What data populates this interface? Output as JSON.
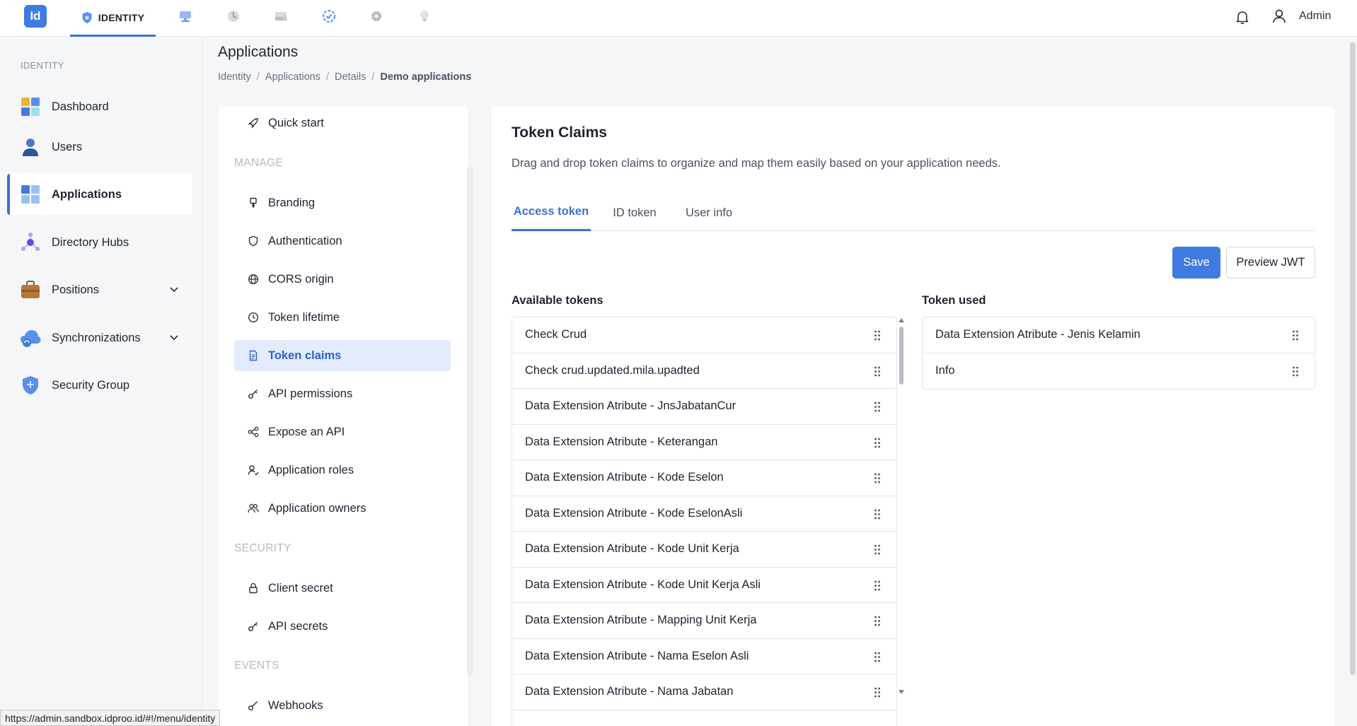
{
  "app": {
    "logo_text": "Id",
    "active_module": "IDENTITY",
    "top_icons": [
      "monitor-icon",
      "history-icon",
      "drive-icon",
      "badge-check-icon",
      "gear-icon",
      "bulb-icon"
    ],
    "user_label": "Admin"
  },
  "sidebar": {
    "section": "IDENTITY",
    "items": [
      {
        "label": "Dashboard",
        "icon": "dashboard-icon"
      },
      {
        "label": "Users",
        "icon": "user-icon"
      },
      {
        "label": "Applications",
        "icon": "applications-icon",
        "active": true
      },
      {
        "label": "Directory Hubs",
        "icon": "directory-hub-icon"
      },
      {
        "label": "Positions",
        "icon": "briefcase-icon",
        "expandable": true
      },
      {
        "label": "Synchronizations",
        "icon": "cloud-sync-icon",
        "expandable": true
      },
      {
        "label": "Security Group",
        "icon": "shield-icon"
      }
    ]
  },
  "header": {
    "title": "Applications",
    "breadcrumb": [
      "Identity",
      "Applications",
      "Details",
      "Demo applications"
    ]
  },
  "appnav": {
    "quick_start": "Quick start",
    "manage_section": "MANAGE",
    "manage": [
      "Branding",
      "Authentication",
      "CORS origin",
      "Token lifetime",
      "Token claims",
      "API permissions",
      "Expose an API",
      "Application roles",
      "Application owners"
    ],
    "security_section": "SECURITY",
    "security": [
      "Client secret",
      "API secrets"
    ],
    "events_section": "EVENTS",
    "events": [
      "Webhooks"
    ]
  },
  "main": {
    "title": "Token Claims",
    "description": "Drag and drop token claims to organize and map them easily based on your application needs.",
    "tabs": [
      "Access token",
      "ID token",
      "User info"
    ],
    "save_label": "Save",
    "preview_label": "Preview JWT",
    "available_heading": "Available tokens",
    "used_heading": "Token used",
    "available": [
      "Check Crud",
      "Check crud.updated.mila.upadted",
      "Data Extension Atribute - JnsJabatanCur",
      "Data Extension Atribute - Keterangan",
      "Data Extension Atribute - Kode Eselon",
      "Data Extension Atribute - Kode EselonAsli",
      "Data Extension Atribute - Kode Unit Kerja",
      "Data Extension Atribute - Kode Unit Kerja Asli",
      "Data Extension Atribute - Mapping Unit Kerja",
      "Data Extension Atribute - Nama Eselon Asli",
      "Data Extension Atribute - Nama Jabatan"
    ],
    "used": [
      "Data Extension Atribute - Jenis Kelamin",
      "Info"
    ]
  },
  "status_url": "https://admin.sandbox.idproo.id/#!/menu/identity"
}
